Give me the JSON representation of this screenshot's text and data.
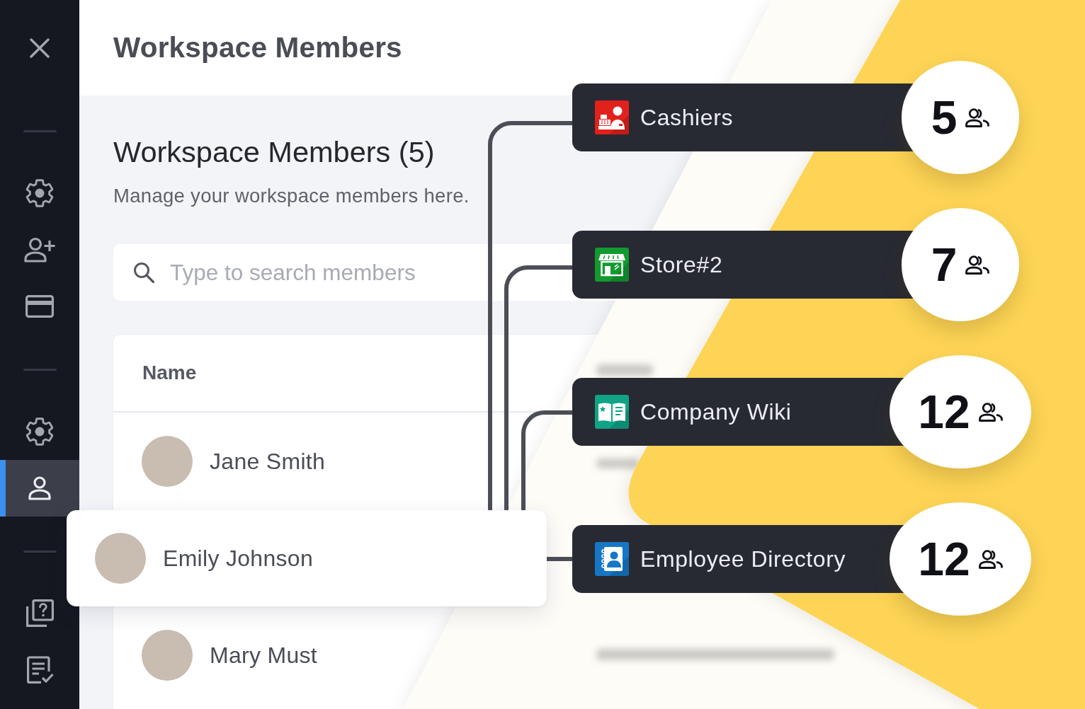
{
  "sidebar": {
    "sections": [
      {
        "items": [
          {
            "selected": false
          },
          {
            "selected": false
          },
          {
            "selected": false
          }
        ]
      },
      {
        "items": [
          {
            "selected": false
          },
          {
            "selected": true
          }
        ]
      },
      {
        "items": [
          {
            "selected": false
          },
          {
            "selected": false
          }
        ]
      }
    ]
  },
  "header": {
    "title": "Workspace Members"
  },
  "section": {
    "title": "Workspace Members (5)",
    "description": "Manage your workspace members here."
  },
  "search": {
    "placeholder": "Type to search members"
  },
  "table": {
    "columns": [
      "Name"
    ],
    "rows": [
      {
        "name": "Jane Smith",
        "selected": false
      },
      {
        "name": "Emily Johnson",
        "selected": true
      },
      {
        "name": "Mary Must",
        "selected": false
      }
    ]
  },
  "groups": [
    {
      "name": "Cashiers",
      "count": "5",
      "color": "#e3211c"
    },
    {
      "name": "Store#2",
      "count": "7",
      "color": "#139a2f"
    },
    {
      "name": "Company Wiki",
      "count": "12",
      "color": "#10a386"
    },
    {
      "name": "Employee Directory",
      "count": "12",
      "color": "#1677c6"
    }
  ]
}
